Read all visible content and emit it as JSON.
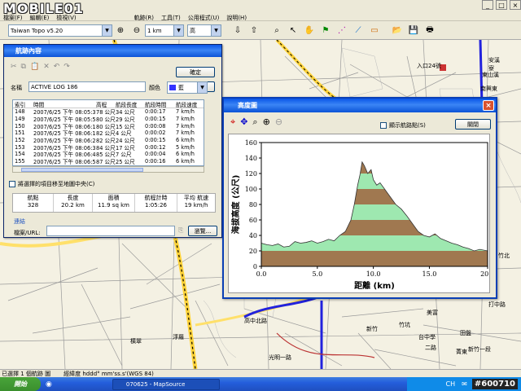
{
  "watermark": {
    "text": "MOBILE01"
  },
  "menu": {
    "items": [
      "檔案(F)",
      "編輯(E)",
      "檢視(V)",
      "",
      "軌跡(R)",
      "工具(T)",
      "公用程式(U)",
      "說明(H)"
    ]
  },
  "toolbar": {
    "map_product": "Taiwan Topo v5.20",
    "zoom_scale": "1 km",
    "detail_level": "高"
  },
  "map": {
    "labels": [
      "入口24號",
      "安溪",
      "寮",
      "東山溪",
      "竹北",
      "美富",
      "打中路",
      "竹坑",
      "田盤",
      "菁東",
      "二路",
      "新竹",
      "台中學",
      "新竹一段",
      "浮羅",
      "高中北路",
      "橫翠",
      "光明一路",
      "南興東"
    ]
  },
  "track_dialog": {
    "title": "航跡內容",
    "ok_label": "確定",
    "cancel_label": "取消",
    "name_label": "名稱",
    "name_value": "ACTIVE LOG 186",
    "color_label": "顏色",
    "color_value": "藍",
    "color_swatch": "#3333ff",
    "table_headers": [
      "索引",
      "時間",
      "高程",
      "航段長度",
      "航段時間",
      "航段速度"
    ],
    "rows": [
      [
        "148",
        "2007/6/25 下午 08:05:38",
        "78 公尺",
        "34 公尺",
        "0:00:17",
        "7 km/h"
      ],
      [
        "149",
        "2007/6/25 下午 08:05:55",
        "80 公尺",
        "29 公尺",
        "0:00:15",
        "7 km/h"
      ],
      [
        "150",
        "2007/6/25 下午 08:06:10",
        "80 公尺",
        "15 公尺",
        "0:00:08",
        "7 km/h"
      ],
      [
        "151",
        "2007/6/25 下午 08:06:18",
        "82 公尺",
        "4 公尺",
        "0:00:02",
        "7 km/h"
      ],
      [
        "152",
        "2007/6/25 下午 08:06:20",
        "82 公尺",
        "24 公尺",
        "0:00:15",
        "6 km/h"
      ],
      [
        "153",
        "2007/6/25 下午 08:06:35",
        "84 公尺",
        "17 公尺",
        "0:00:12",
        "5 km/h"
      ],
      [
        "154",
        "2007/6/25 下午 08:06:47",
        "85 公尺",
        "7 公尺",
        "0:00:04",
        "6 km/h"
      ],
      [
        "155",
        "2007/6/25 下午 08:06:51",
        "87 公尺",
        "25 公尺",
        "0:00:16",
        "6 km/h"
      ]
    ],
    "center_checkbox_label": "將選擇的項目移至地圖中央(C)",
    "summary_headers": [
      "航點",
      "長度",
      "面積",
      "航程計時",
      "平均 航速"
    ],
    "summary_values": [
      "328",
      "20.2 km",
      "11.9 sq km",
      "1:05:26",
      "19 km/h"
    ],
    "link_section_label": "連結",
    "file_url_label": "檔案/URL:",
    "browse_label": "瀏覽..."
  },
  "profile_window": {
    "title": "高度圖",
    "show_points_label": "顯示航路點(S)",
    "close_label": "關閉"
  },
  "status": {
    "left": "已選擇 1 個航跡 圖",
    "coord_format": "經緯度 hddd° mm'ss.s'(WGS 84)"
  },
  "taskbar": {
    "start_label": "開始",
    "task_label": "070625 - MapSource",
    "lang": "CH",
    "tag": "#600710"
  },
  "chart_data": {
    "type": "area",
    "title": "",
    "xlabel": "距離 (km)",
    "ylabel": "海拔高度 (公尺)",
    "xlim": [
      0,
      20.2
    ],
    "ylim": [
      0,
      160
    ],
    "xticks": [
      "0.0",
      "5.0",
      "10.0",
      "15.0",
      "20.2"
    ],
    "yticks": [
      "0",
      "20",
      "40",
      "60",
      "80",
      "100",
      "120",
      "140",
      "160"
    ],
    "band_colors": [
      "#a07850",
      "#9ee8b0"
    ],
    "series": [
      {
        "x": [
          0.0,
          0.5,
          1.0,
          1.5,
          2.0,
          2.5,
          3.0,
          3.5,
          4.0,
          4.5,
          5.0,
          5.5,
          6.0,
          6.5,
          7.0,
          7.5,
          8.0,
          8.3,
          8.6,
          8.8,
          9.0,
          9.2,
          9.5,
          9.8,
          10.0,
          10.3,
          10.6,
          11.0,
          11.5,
          12.0,
          12.5,
          13.0,
          13.5,
          14.0,
          14.5,
          15.0,
          15.5,
          16.0,
          16.5,
          17.0,
          17.5,
          18.0,
          18.5,
          19.0,
          19.5,
          20.2
        ],
        "y": [
          30,
          28,
          27,
          29,
          25,
          26,
          32,
          30,
          31,
          33,
          30,
          32,
          35,
          33,
          40,
          45,
          60,
          80,
          105,
          118,
          135,
          130,
          120,
          125,
          112,
          105,
          108,
          100,
          90,
          80,
          74,
          65,
          55,
          45,
          40,
          38,
          42,
          36,
          33,
          30,
          28,
          25,
          23,
          20,
          22,
          20
        ]
      }
    ]
  }
}
